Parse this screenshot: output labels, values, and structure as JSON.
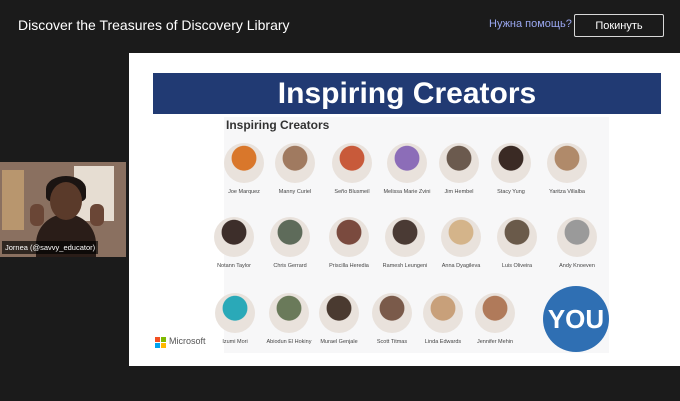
{
  "meeting": {
    "title": "Discover the Treasures of Discovery Library",
    "help_label": "Нужна помощь?",
    "leave_label": "Покинуть"
  },
  "presenter": {
    "name_tag": "Jornea (@savvy_educator)"
  },
  "slide": {
    "banner_title": "Inspiring Creators",
    "inner_title": "Inspiring Creators",
    "you_label": "YOU",
    "footer_brand": "Microsoft",
    "creators": [
      {
        "name": "Joe Marquez",
        "color": "#d9772b"
      },
      {
        "name": "Manny Curiel",
        "color": "#a07a60"
      },
      {
        "name": "Seño Blusmeil",
        "color": "#c85a3a"
      },
      {
        "name": "Melissa Marie Zvini",
        "color": "#8c6db8"
      },
      {
        "name": "Jim Hembel",
        "color": "#6b5a4e"
      },
      {
        "name": "Stacy Yung",
        "color": "#3a2a24"
      },
      {
        "name": "Yaritza Villalba",
        "color": "#b08a6a"
      },
      {
        "name": "Notann Taylor",
        "color": "#3d2e2a"
      },
      {
        "name": "Chris Gerrard",
        "color": "#5e6b5a"
      },
      {
        "name": "Priscilla Heredia",
        "color": "#7a4a3e"
      },
      {
        "name": "Ramesh Leungeni",
        "color": "#4a3a34"
      },
      {
        "name": "Anna Dyagileva",
        "color": "#d4b48a"
      },
      {
        "name": "Luis Oliveira",
        "color": "#6a5a4a"
      },
      {
        "name": "Andy Knoeven",
        "color": "#9a9a9a"
      },
      {
        "name": "Izumi Mori",
        "color": "#2aa9b8"
      },
      {
        "name": "Abiodun El Hokiny",
        "color": "#6a7a5a"
      },
      {
        "name": "Murael Genjale",
        "color": "#4a3a30"
      },
      {
        "name": "Scott Titmas",
        "color": "#7a5a4a"
      },
      {
        "name": "Linda Edwards",
        "color": "#c8a07a"
      },
      {
        "name": "Jennifer Mehin",
        "color": "#b07a5a"
      }
    ]
  },
  "colors": {
    "banner": "#213a73",
    "you_circle": "#2f6fb3",
    "help_link": "#9aa7f0",
    "ms_logo": [
      "#f25022",
      "#7fba00",
      "#00a4ef",
      "#ffb900"
    ]
  }
}
